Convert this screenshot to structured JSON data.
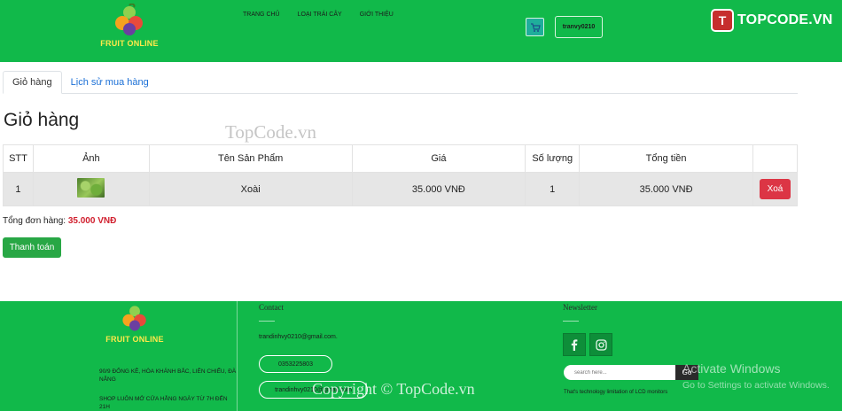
{
  "header": {
    "logo_text": "FRUIT ONLINE",
    "nav": [
      "TRANG CHỦ",
      "LOẠI TRÁI CÂY",
      "GIỚI THIỆU"
    ],
    "user_label": "tranvy0210",
    "watermark_logo": "TOPCODE.VN"
  },
  "tabs": [
    {
      "label": "Giỏ hàng",
      "active": true
    },
    {
      "label": "Lịch sử mua hàng",
      "active": false
    }
  ],
  "page_title": "Giỏ hàng",
  "watermark_center": "TopCode.vn",
  "table": {
    "headers": [
      "STT",
      "Ảnh",
      "Tên Sản Phẩm",
      "Giá",
      "Số lượng",
      "Tổng tiền",
      ""
    ],
    "rows": [
      {
        "stt": "1",
        "image": "fruit-image",
        "name": "Xoài",
        "price": "35.000 VNĐ",
        "qty": "1",
        "total": "35.000 VNĐ",
        "action": "Xoá"
      }
    ]
  },
  "summary": {
    "label": "Tổng đơn hàng:",
    "value": "35.000 VNĐ"
  },
  "pay_button": "Thanh toán",
  "footer": {
    "logo_text": "FRUIT ONLINE",
    "address": "90/9 ĐỐNG KÊ, HÒA KHÁNH BẮC, LIÊN CHIỂU, ĐÀ NẴNG",
    "hours": "SHOP LUÔN MỞ CỬA HẰNG NGÀY TỪ 7H ĐẾN 21H",
    "contact_heading": "Contact",
    "email": "trandinhvy0210@gmail.com.",
    "phone": "0353225803",
    "facebook": "trandinhvy0210@gmail.com",
    "newsletter_heading": "Newsletter",
    "search_placeholder": "search here...",
    "go_label": "Go",
    "note": "That's technology limitation of LCD monitors"
  },
  "overlays": {
    "windows_activate": "Activate Windows",
    "windows_sub": "Go to Settings to activate Windows.",
    "copyright": "Copyright © TopCode.vn"
  },
  "colors": {
    "brand_green": "#11b94a",
    "danger": "#dc3545",
    "success": "#28a745",
    "link": "#1a6fd6"
  }
}
